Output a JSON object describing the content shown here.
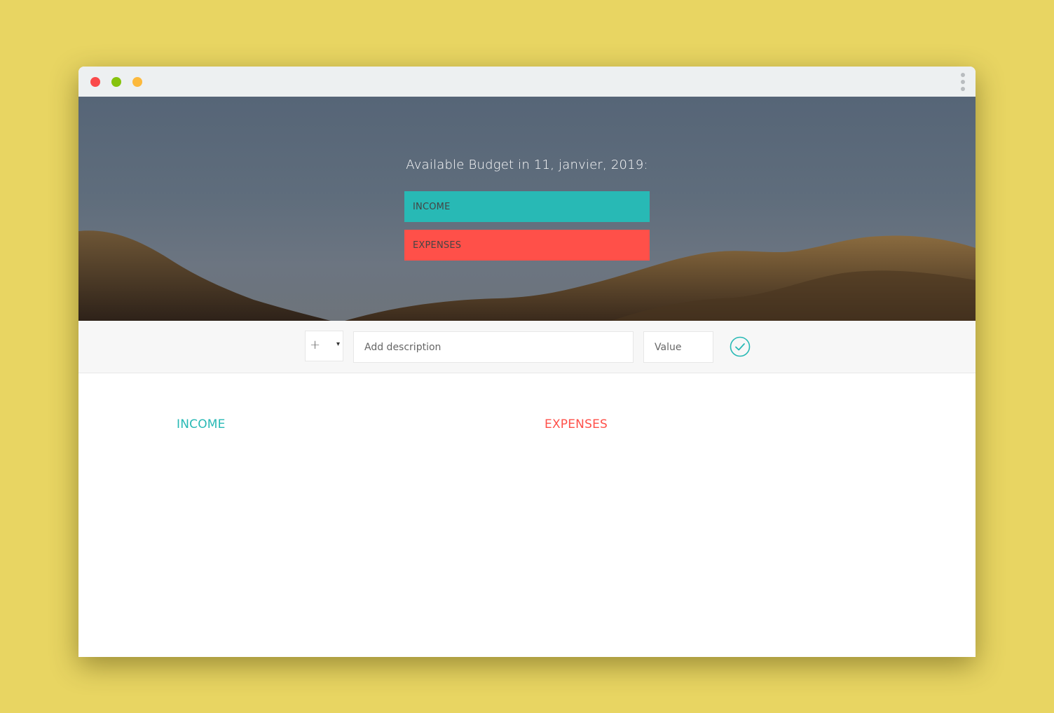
{
  "budget": {
    "title": "Available Budget in 11, janvier, 2019:",
    "income_label": "INCOME",
    "expenses_label": "EXPENSES"
  },
  "add_bar": {
    "type_symbol": "+",
    "type_caret": "▾",
    "description_placeholder": "Add description",
    "value_placeholder": "Value",
    "submit_icon": "check-circle-icon"
  },
  "lists": {
    "income_title": "INCOME",
    "expenses_title": "EXPENSES"
  },
  "colors": {
    "background": "#e8d562",
    "income": "#28b9b5",
    "expenses": "#ff5049"
  }
}
